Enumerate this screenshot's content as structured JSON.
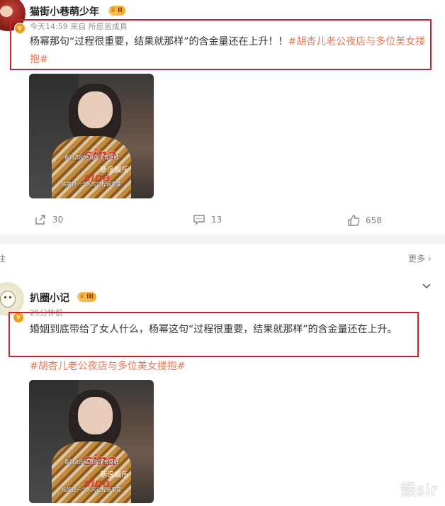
{
  "post1": {
    "username": "猫街小巷萌少年",
    "level": "II",
    "meta": "今天14:59  来自 所愿皆成真",
    "text": "杨幂那句“过程很重要，结果就那样”的含金量还在上升！！",
    "topic": "#胡杏儿老公夜店与多位美女搂抱#",
    "thumb": {
      "logo": "sina",
      "logo_cn": "新浪娱乐",
      "sub1": "看到这段话真的深有感触",
      "sub2": "结婚是一个人的过程很重要"
    },
    "actions": {
      "repost": "30",
      "comment": "13",
      "like": "658"
    }
  },
  "divider": {
    "left_label": "注",
    "more_label": "更多 ›"
  },
  "post2": {
    "username": "扒圈小记",
    "level": "III",
    "meta": "25分钟前",
    "text": "婚姻到底带给了女人什么，杨幂这句“过程很重要，结果就那样”的含金量还在上升。",
    "topic": "#胡杏儿老公夜店与多位美女搂抱#",
    "thumb": {
      "logo": "sina",
      "logo_cn": "新浪娱乐",
      "sub1": "看到这段话真的深有感触",
      "sub2": "结婚是一个人的过程很重要"
    }
  },
  "watermark": "娱sir",
  "colors": {
    "highlight_box": "#c4242b",
    "topic": "#eb7350",
    "badge": "#f49a1a"
  },
  "icons": [
    "repost-icon",
    "comment-icon",
    "like-icon",
    "chevron-down-icon",
    "vip-badge-icon",
    "crown-icon"
  ]
}
